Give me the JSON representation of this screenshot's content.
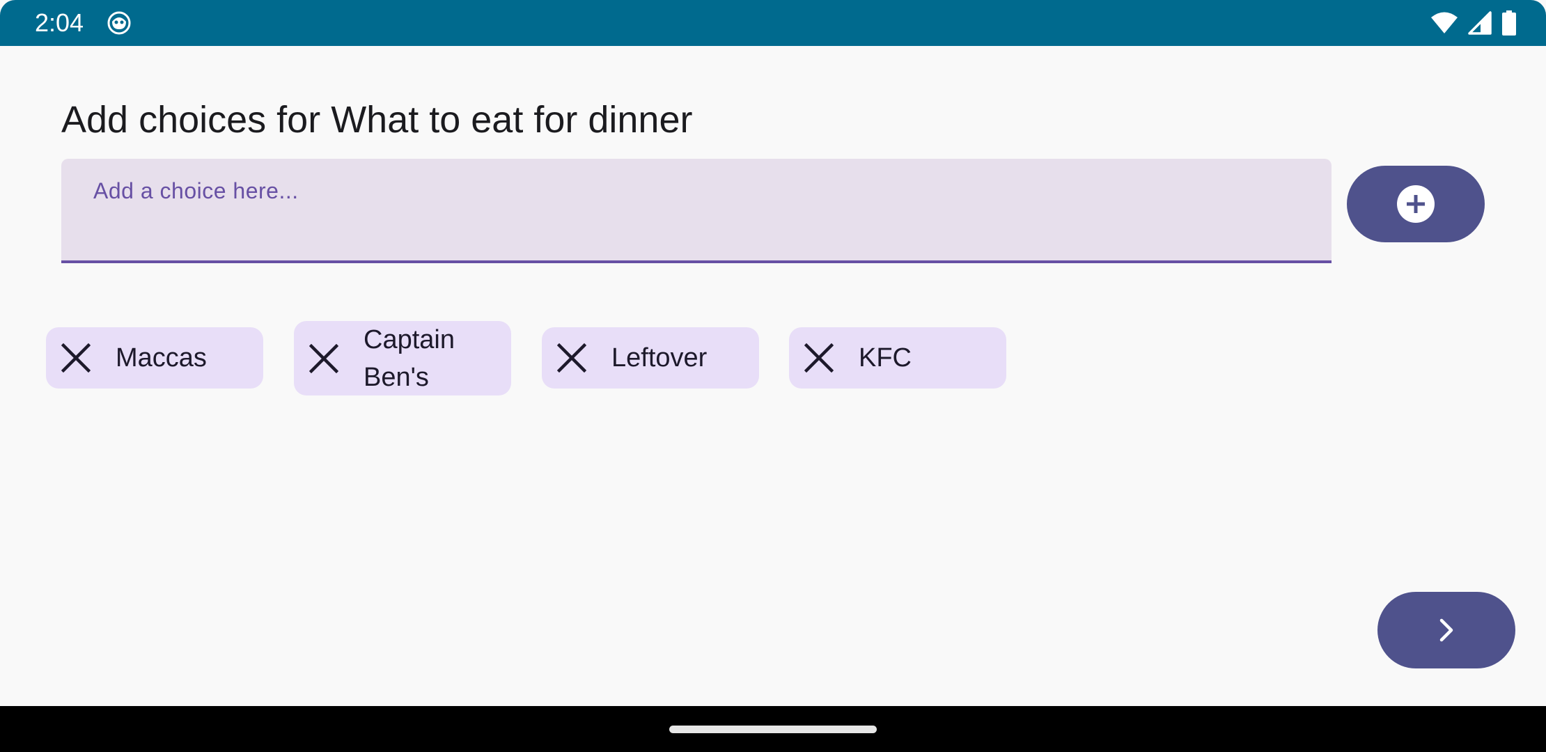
{
  "status_bar": {
    "time": "2:04",
    "background_color": "#006A8E",
    "icons": [
      "app-notification-icon",
      "wifi-icon",
      "cell-signal-icon",
      "battery-icon"
    ]
  },
  "screen": {
    "title": "Add choices for What to eat for dinner"
  },
  "choice_input": {
    "placeholder": "Add a choice here...",
    "value": ""
  },
  "add_button": {
    "icon": "add-circle-icon"
  },
  "choices": [
    {
      "label": "Maccas",
      "icon": "close-icon"
    },
    {
      "label": "Captain Ben's",
      "icon": "close-icon"
    },
    {
      "label": "Leftover",
      "icon": "close-icon"
    },
    {
      "label": "KFC",
      "icon": "close-icon"
    }
  ],
  "next_button": {
    "icon": "chevron-right-icon"
  },
  "colors": {
    "background": "#F9F9F9",
    "input_fill": "#E7DFEC",
    "accent": "#6750A4",
    "button": "#4F528C",
    "chip": "#E8DEF8",
    "chip_text": "#1D192B"
  }
}
